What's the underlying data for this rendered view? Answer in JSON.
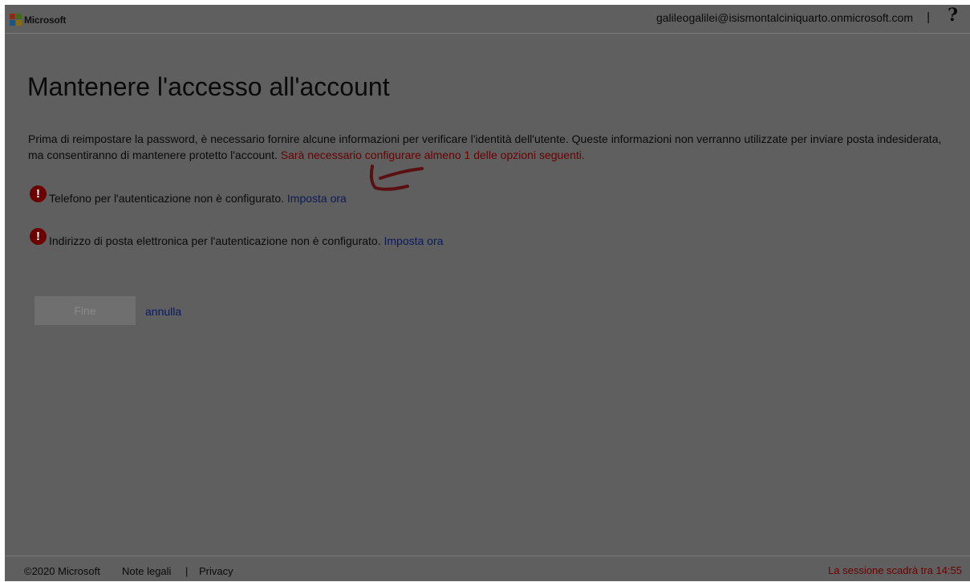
{
  "header": {
    "brand": "Microsoft",
    "user_email": "galileogalilei@isismontalciniquarto.onmicrosoft.com",
    "separator": "|",
    "help": "?"
  },
  "main": {
    "title": "Mantenere l'accesso all'account",
    "intro_text": "Prima di reimpostare la password, è necessario fornire alcune informazioni per verificare l'identità dell'utente. Queste informazioni non verranno utilizzate per inviare posta indesiderata, ma consentiranno di mantenere protetto l'account. ",
    "intro_warning": "Sarà necessario configurare almeno 1 delle opzioni seguenti.",
    "items": [
      {
        "icon": "!",
        "text": "Telefono per l'autenticazione non è configurato. ",
        "link": "Imposta ora"
      },
      {
        "icon": "!",
        "text": "Indirizzo di posta elettronica per l'autenticazione non è configurato. ",
        "link": "Imposta ora"
      }
    ],
    "finish_button": "Fine",
    "cancel_link": "annulla"
  },
  "footer": {
    "copyright": "©2020 Microsoft",
    "legal": "Note legali",
    "separator": "|",
    "privacy": "Privacy",
    "session": "La sessione scadrà tra 14:55"
  },
  "colors": {
    "overlay_background": "#5f5f5f",
    "error_icon": "#6b0000",
    "warning_text": "#6a0000",
    "link": "#0a1a5c"
  }
}
